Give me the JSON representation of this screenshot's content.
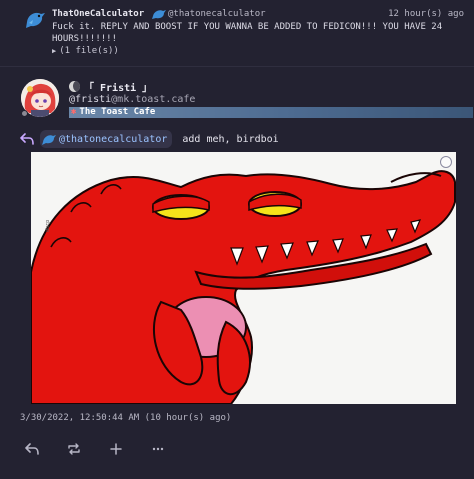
{
  "quoted_post": {
    "author_name": "ThatOneCalculator",
    "author_handle": "@thatonecalculator",
    "relative_time": "12 hour(s) ago",
    "text": "Fuck it. REPLY AND BOOST IF YOU WANNA BE ADDED TO FEDICON!!! YOU HAVE 24 HOURS!!!!!!!",
    "files_toggle": "(1 file(s))"
  },
  "post": {
    "display_name": "「 Fristi 」",
    "handle_user": "@fristi",
    "handle_host": "@mk.toast.cafe",
    "instance_name": "The Toast Cafe",
    "reply_mention": "@thatonecalculator",
    "text": "add meh, birdboi",
    "timestamp": "3/30/2022, 12:50:44 AM (10 hour(s) ago)"
  },
  "actions": [
    {
      "name": "reply",
      "icon": "reply-icon"
    },
    {
      "name": "boost",
      "icon": "repeat-icon"
    },
    {
      "name": "react",
      "icon": "plus-icon"
    },
    {
      "name": "more",
      "icon": "ellipsis-icon"
    }
  ],
  "colors": {
    "background": "#232231",
    "mention": "#9bc3ff",
    "instance_bar": "#4d6b91",
    "gator_red": "#e3140f"
  }
}
